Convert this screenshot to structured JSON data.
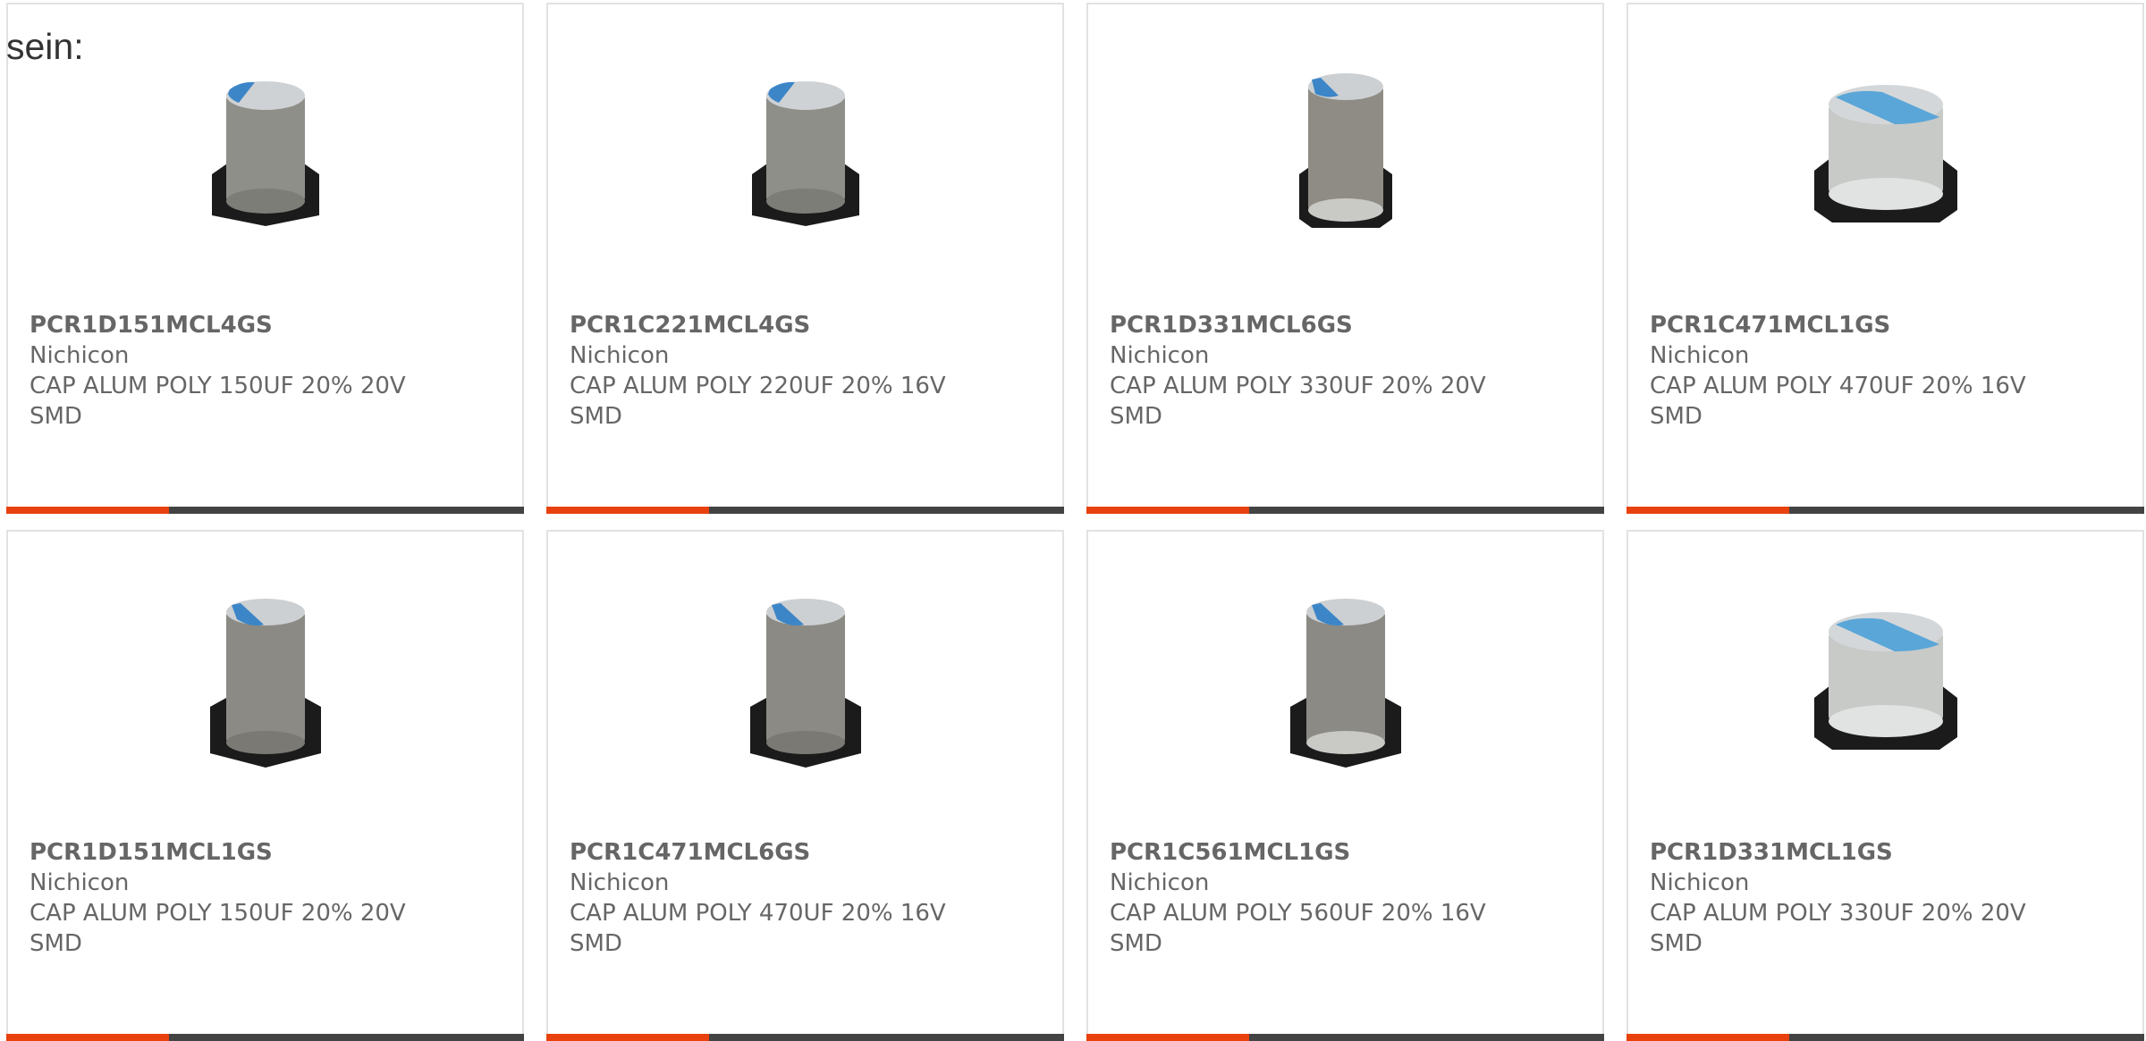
{
  "intro": "sein:",
  "colors": {
    "accent": "#e8410d",
    "bar": "#434343",
    "border": "#e2e2e2",
    "text": "#666666"
  },
  "products": [
    {
      "part": "PCR1D151MCL4GS",
      "maker": "Nichicon",
      "desc": "CAP ALUM POLY 150UF 20% 20V",
      "mount": "SMD",
      "icon": "capacitor-can-image"
    },
    {
      "part": "PCR1C221MCL4GS",
      "maker": "Nichicon",
      "desc": "CAP ALUM POLY 220UF 20% 16V",
      "mount": "SMD",
      "icon": "capacitor-can-image"
    },
    {
      "part": "PCR1D331MCL6GS",
      "maker": "Nichicon",
      "desc": "CAP ALUM POLY 330UF 20% 20V",
      "mount": "SMD",
      "icon": "capacitor-can-image"
    },
    {
      "part": "PCR1C471MCL1GS",
      "maker": "Nichicon",
      "desc": "CAP ALUM POLY 470UF 20% 16V",
      "mount": "SMD",
      "icon": "capacitor-can-image"
    },
    {
      "part": "PCR1D151MCL1GS",
      "maker": "Nichicon",
      "desc": "CAP ALUM POLY 150UF 20% 20V",
      "mount": "SMD",
      "icon": "capacitor-can-image"
    },
    {
      "part": "PCR1C471MCL6GS",
      "maker": "Nichicon",
      "desc": "CAP ALUM POLY 470UF 20% 16V",
      "mount": "SMD",
      "icon": "capacitor-can-image"
    },
    {
      "part": "PCR1C561MCL1GS",
      "maker": "Nichicon",
      "desc": "CAP ALUM POLY 560UF 20% 16V",
      "mount": "SMD",
      "icon": "capacitor-can-image"
    },
    {
      "part": "PCR1D331MCL1GS",
      "maker": "Nichicon",
      "desc": "CAP ALUM POLY 330UF 20% 20V",
      "mount": "SMD",
      "icon": "capacitor-can-image"
    }
  ]
}
